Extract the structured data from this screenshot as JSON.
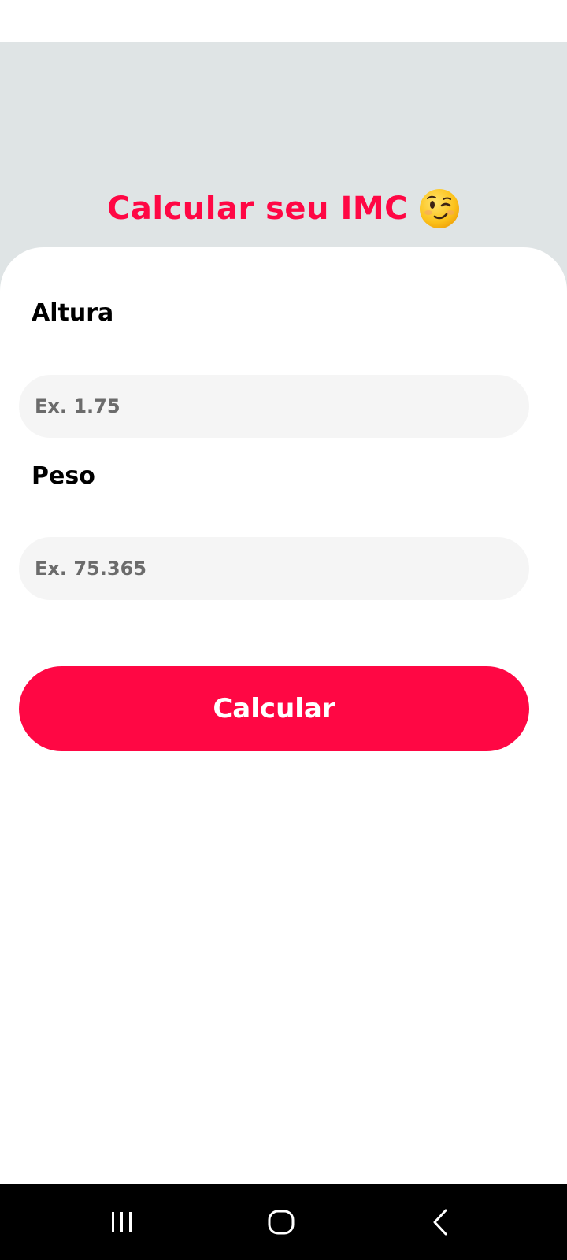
{
  "header": {
    "title": "Calcular seu IMC",
    "title_icon": "winking-face-emoji"
  },
  "form": {
    "altura": {
      "label": "Altura",
      "placeholder": "Ex. 1.75",
      "value": ""
    },
    "peso": {
      "label": "Peso",
      "placeholder": "Ex. 75.365",
      "value": ""
    },
    "submit_label": "Calcular"
  },
  "nav": {
    "items": [
      "recents-icon",
      "home-icon",
      "back-icon"
    ]
  },
  "colors": {
    "accent": "#ff0744",
    "header_bg": "#dfe4e5",
    "input_bg": "#f5f5f5",
    "nav_bg": "#000000"
  }
}
